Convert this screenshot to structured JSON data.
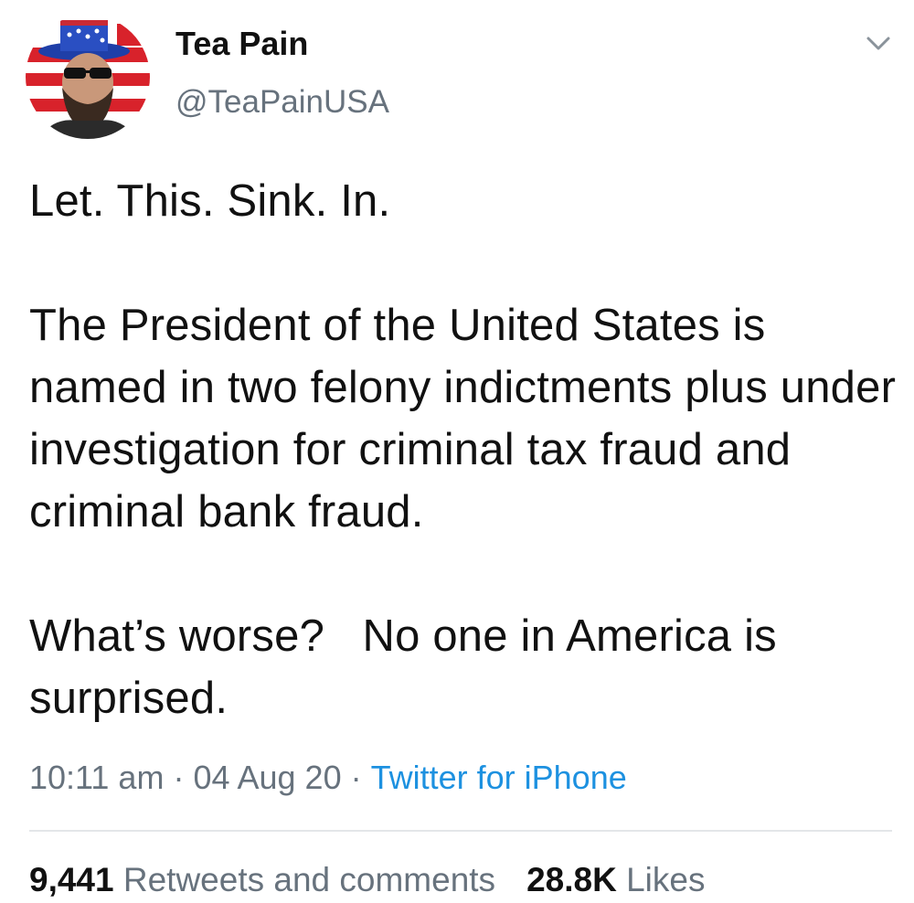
{
  "tweet": {
    "author": {
      "display_name": "Tea Pain",
      "handle": "@TeaPainUSA"
    },
    "menu_icon": "chevron-down-icon",
    "paragraphs": [
      "Let. This. Sink. In.",
      "The President of the United States is named in two felony indictments plus under investigation for criminal tax fraud and criminal bank fraud.",
      "What’s worse?   No one in America is surprised."
    ],
    "meta": {
      "time": "10:11 am",
      "date": "04 Aug 20",
      "separator": "·",
      "source": "Twitter for iPhone"
    },
    "stats": {
      "retweets_count": "9,441",
      "retweets_label": "Retweets and comments",
      "likes_count": "28.8K",
      "likes_label": "Likes"
    },
    "colors": {
      "text": "#111111",
      "secondary": "#67727d",
      "link": "#1d91e0",
      "divider": "#e3e6e9"
    }
  }
}
